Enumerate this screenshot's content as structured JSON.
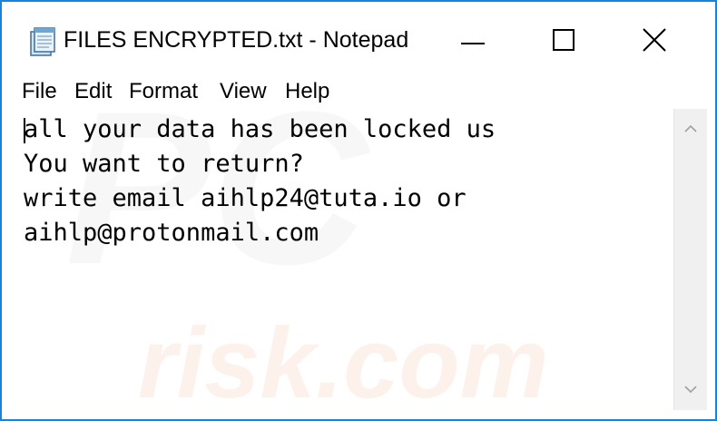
{
  "window": {
    "title": "FILES ENCRYPTED.txt - Notepad",
    "accent_color": "#1883d7",
    "icon": "notepad-icon"
  },
  "controls": {
    "minimize_icon": "minimize-icon",
    "maximize_icon": "maximize-icon",
    "close_icon": "close-icon"
  },
  "menu": {
    "items": [
      "File",
      "Edit",
      "Format",
      "View",
      "Help"
    ]
  },
  "document": {
    "lines": [
      "all your data has been locked us",
      "You want to return?",
      "write email aihlp24@tuta.io or",
      "aihlp@protonmail.com"
    ]
  },
  "watermark": {
    "brand": "PC",
    "site": "risk.com"
  },
  "scrollbar": {
    "up_icon": "chevron-up-icon",
    "down_icon": "chevron-down-icon"
  }
}
